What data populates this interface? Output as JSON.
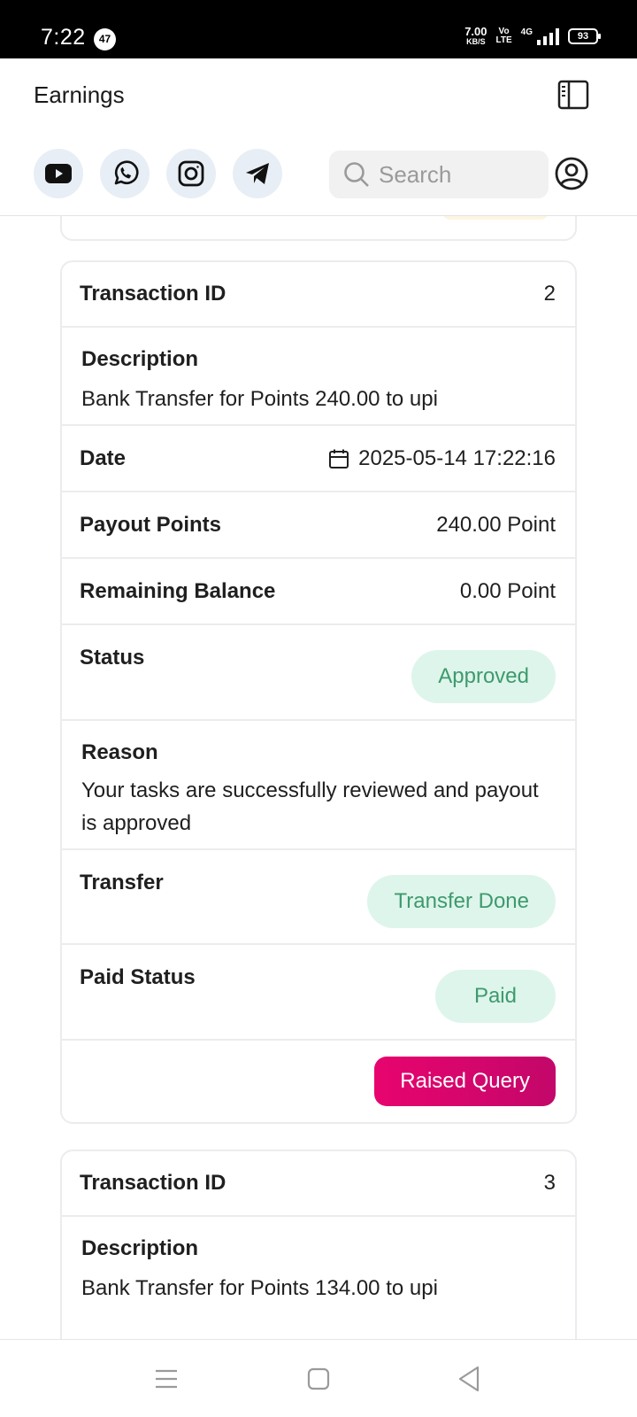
{
  "status_bar": {
    "time": "7:22",
    "notification_count": "47",
    "net_speed": "7.00",
    "net_speed_unit": "KB/S",
    "volte_top": "Vo",
    "volte_bottom": "LTE",
    "network": "4G",
    "battery": "93"
  },
  "header": {
    "title": "Earnings",
    "search_placeholder": "Search",
    "social_icons": [
      "youtube-icon",
      "whatsapp-icon",
      "instagram-icon",
      "telegram-icon"
    ]
  },
  "transactions": [
    {
      "id_label": "Transaction ID",
      "id": "2",
      "description_label": "Description",
      "description": "Bank Transfer for Points 240.00 to upi",
      "date_label": "Date",
      "date": "2025-05-14 17:22:16",
      "payout_label": "Payout Points",
      "payout": "240.00 Point",
      "balance_label": "Remaining Balance",
      "balance": "0.00 Point",
      "status_label": "Status",
      "status": "Approved",
      "reason_label": "Reason",
      "reason": "Your tasks are successfully reviewed and payout is approved",
      "transfer_label": "Transfer",
      "transfer": "Transfer Done",
      "paid_label": "Paid Status",
      "paid": "Paid",
      "query_button": "Raised Query"
    },
    {
      "id_label": "Transaction ID",
      "id": "3",
      "description_label": "Description",
      "description": "Bank Transfer for Points 134.00 to upi"
    }
  ],
  "colors": {
    "accent": "#e8046e",
    "success_bg": "#def5eb",
    "success_text": "#3e9a6d"
  }
}
